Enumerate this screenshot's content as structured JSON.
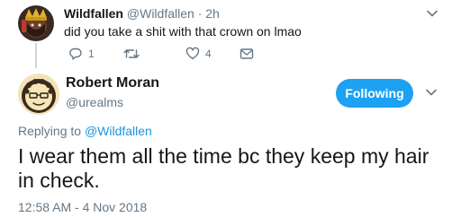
{
  "parent_tweet": {
    "display_name": "Wildfallen",
    "handle": "@Wildfallen",
    "separator": "·",
    "timestamp": "2h",
    "text": "did you take a shit with that crown on lmao",
    "actions": {
      "reply_count": "1",
      "retweet_count": "",
      "like_count": "4"
    }
  },
  "main_tweet": {
    "display_name": "Robert Moran",
    "handle": "@urealms",
    "follow_button_label": "Following",
    "replying_prefix": "Replying to",
    "replying_to": "@Wildfallen",
    "text": "I wear them all the time bc they keep my hair in check.",
    "timestamp": "12:58 AM - 4 Nov 2018"
  },
  "colors": {
    "accent": "#1da1f2",
    "link": "#1b95e0",
    "secondary_text": "#657786",
    "primary_text": "#14171a"
  },
  "icons": {
    "reply": "reply-icon",
    "retweet": "retweet-icon",
    "like": "heart-icon",
    "message": "envelope-icon",
    "menu": "chevron-down-icon"
  }
}
